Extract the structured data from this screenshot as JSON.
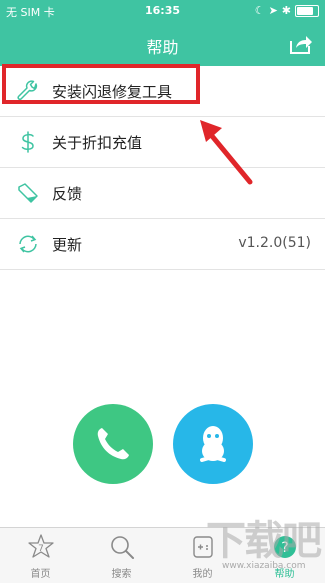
{
  "status_bar": {
    "carrier": "无 SIM 卡",
    "time": "16:35",
    "battery_level": 0.9
  },
  "nav": {
    "title": "帮助",
    "share_icon": "share-icon"
  },
  "menu": [
    {
      "label": "安装闪退修复工具",
      "icon": "wrench-icon"
    },
    {
      "label": "关于折扣充值",
      "icon": "dollar-icon"
    },
    {
      "label": "反馈",
      "icon": "tag-icon"
    },
    {
      "label": "更新",
      "icon": "refresh-icon",
      "value": "v1.2.0(51)"
    }
  ],
  "contact": {
    "phone_icon": "phone-icon",
    "qq_icon": "qq-icon",
    "phone_color": "#3ec783",
    "qq_color": "#27b7e8"
  },
  "tabs": [
    {
      "label": "首页",
      "icon": "home-icon"
    },
    {
      "label": "搜索",
      "icon": "search-icon"
    },
    {
      "label": "我的",
      "icon": "gamepad-icon"
    },
    {
      "label": "帮助",
      "icon": "help-icon",
      "active": true
    }
  ],
  "watermark": {
    "text": "下载吧",
    "url": "www.xiazaiba.com"
  },
  "colors": {
    "accent": "#3fc4a2",
    "highlight": "#e0262a"
  }
}
